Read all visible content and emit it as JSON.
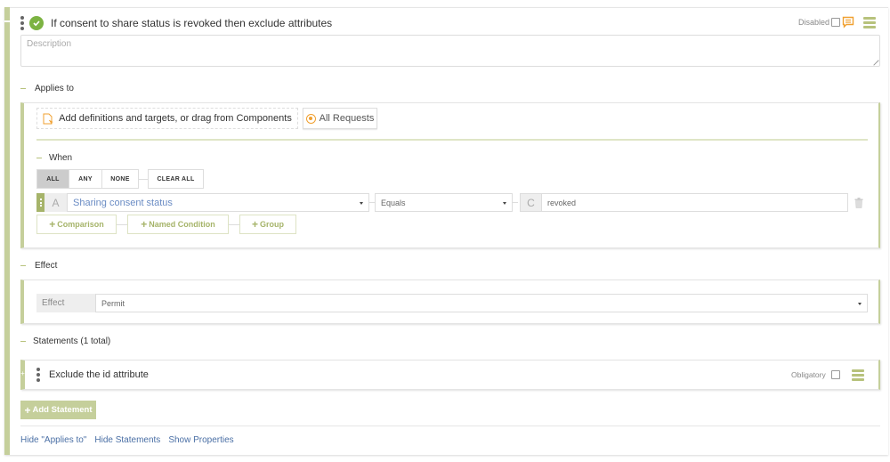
{
  "rule": {
    "title": "If consent to share status is revoked then exclude attributes",
    "status_icon": "check-circle-icon",
    "disabled_label": "Disabled",
    "disabled_checked": false,
    "comment_icon": "comment-icon",
    "menu_icon": "hamburger-menu-icon",
    "description_placeholder": "Description",
    "description_value": ""
  },
  "applies_to": {
    "label": "Applies to",
    "add_button_label": "Add definitions and targets, or drag from Components",
    "all_requests_label": "All Requests",
    "when": {
      "label": "When",
      "logic_buttons": [
        "ALL",
        "ANY",
        "NONE"
      ],
      "selected_logic": "ALL",
      "clear_all_label": "CLEAR ALL",
      "condition": {
        "left_tag": "A",
        "attribute": "Sharing consent status",
        "operator": "Equals",
        "right_tag": "C",
        "value": "revoked"
      },
      "add_buttons": [
        "Comparison",
        "Named Condition",
        "Group"
      ]
    }
  },
  "effect": {
    "label": "Effect",
    "field_label": "Effect",
    "value": "Permit"
  },
  "statements": {
    "label": "Statements (1 total)",
    "items": [
      {
        "title": "Exclude the id attribute",
        "obligatory_label": "Obligatory",
        "obligatory_checked": false
      }
    ],
    "add_label": "Add Statement"
  },
  "footer_links": [
    "Hide \"Applies to\"",
    "Hide Statements",
    "Show Properties"
  ],
  "colors": {
    "accent_green": "#c5cf9b",
    "check_green": "#7cb342",
    "comment_orange": "#f0a030",
    "link_blue": "#4a6fa5",
    "attribute_blue": "#6a8cc4"
  }
}
